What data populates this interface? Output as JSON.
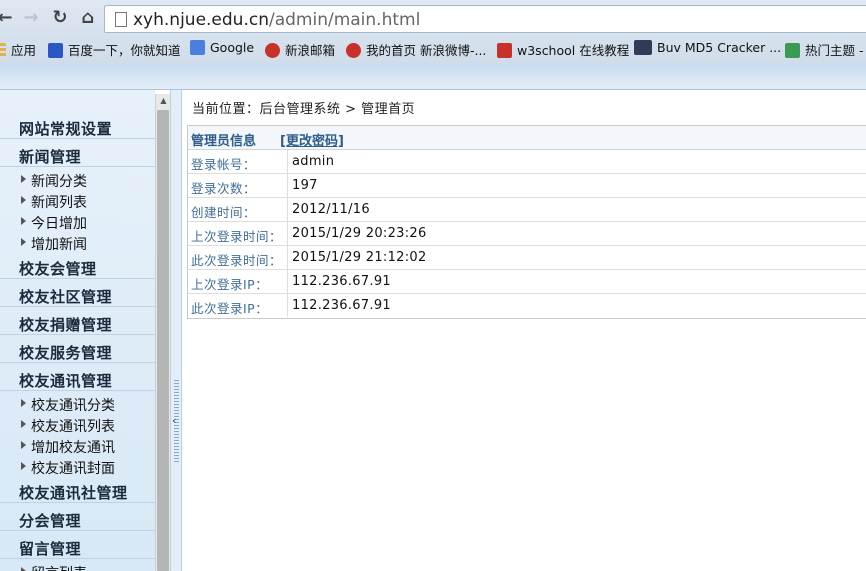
{
  "browser": {
    "url_host": "xyh.njue.edu.cn",
    "url_path": "/admin/main.html",
    "bookmarks": [
      {
        "label": "应用",
        "color": "#e8b04a"
      },
      {
        "label": "百度一下，你就知道",
        "color": "#2a56c6"
      },
      {
        "label": "Google",
        "color": "#4a7fe0"
      },
      {
        "label": "新浪邮箱",
        "color": "#c8302a"
      },
      {
        "label": "我的首页 新浪微博-...",
        "color": "#c8302a"
      },
      {
        "label": "w3school 在线教程",
        "color": "#c8302a"
      },
      {
        "label": "Buv MD5 Cracker ...",
        "color": "#333a55"
      },
      {
        "label": "热门主题 -",
        "color": "#3a9a55"
      }
    ]
  },
  "sidebar": {
    "entries": [
      {
        "type": "group",
        "label": "网站常规设置"
      },
      {
        "type": "group",
        "label": "新闻管理"
      },
      {
        "type": "item",
        "label": "新闻分类"
      },
      {
        "type": "item",
        "label": "新闻列表"
      },
      {
        "type": "item",
        "label": "今日增加"
      },
      {
        "type": "item",
        "label": "增加新闻"
      },
      {
        "type": "group",
        "label": "校友会管理"
      },
      {
        "type": "group",
        "label": "校友社区管理"
      },
      {
        "type": "group",
        "label": "校友捐赠管理"
      },
      {
        "type": "group",
        "label": "校友服务管理"
      },
      {
        "type": "group",
        "label": "校友通讯管理"
      },
      {
        "type": "item",
        "label": "校友通讯分类"
      },
      {
        "type": "item",
        "label": "校友通讯列表"
      },
      {
        "type": "item",
        "label": "增加校友通讯"
      },
      {
        "type": "item",
        "label": "校友通讯封面"
      },
      {
        "type": "group",
        "label": "校友通讯社管理"
      },
      {
        "type": "group",
        "label": "分会管理"
      },
      {
        "type": "group",
        "label": "留言管理"
      },
      {
        "type": "item",
        "label": "留言列表"
      }
    ]
  },
  "main": {
    "breadcrumb": "当前位置：后台管理系统 > 管理首页",
    "info_title": "管理员信息",
    "change_password": "[更改密码]",
    "rows": [
      {
        "key": "登录帐号：",
        "value": "admin"
      },
      {
        "key": "登录次数：",
        "value": "197"
      },
      {
        "key": "创建时间：",
        "value": "2012/11/16"
      },
      {
        "key": "上次登录时间：",
        "value": "2015/1/29 20:23:26"
      },
      {
        "key": "此次登录时间：",
        "value": "2015/1/29 21:12:02"
      },
      {
        "key": "上次登录IP：",
        "value": "112.236.67.91"
      },
      {
        "key": "此次登录IP：",
        "value": "112.236.67.91"
      }
    ]
  }
}
